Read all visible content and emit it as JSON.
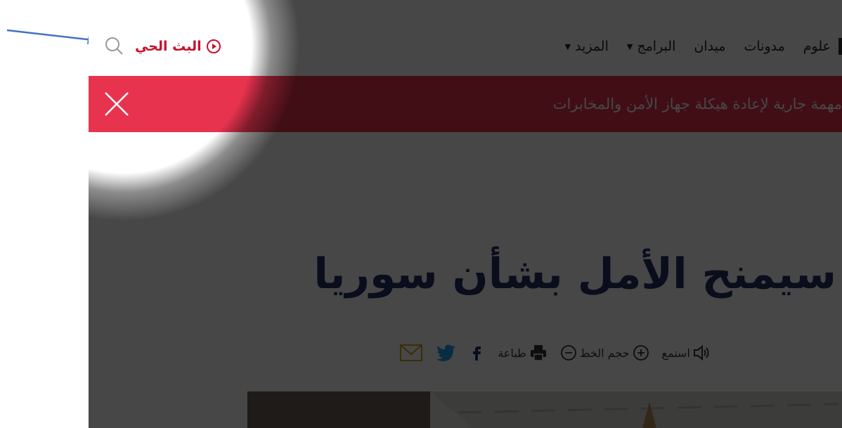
{
  "header": {
    "live_label": "البث الحي",
    "search_icon": "search-icon",
    "nav": [
      {
        "label": "علوم",
        "dropdown": false
      },
      {
        "label": "مدونات",
        "dropdown": false
      },
      {
        "label": "ميدان",
        "dropdown": false
      },
      {
        "label": "البرامج",
        "dropdown": true
      },
      {
        "label": "المزيد",
        "dropdown": true
      }
    ]
  },
  "alert": {
    "text": "مهمة جارية لإعادة هيكلة جهاز الأمن والمخابرات",
    "close_icon": "close-icon",
    "color": "#e8334f"
  },
  "article": {
    "headline": "سيمنح الأمل بشأن سوريا",
    "tools": {
      "listen": "استمع",
      "font_size": "حجم الخط",
      "print": "طباعة"
    }
  },
  "colors": {
    "accent": "#c8102e",
    "headline": "#1f2d64",
    "twitter": "#1da1f2",
    "facebook": "#1c2b6e",
    "email": "#d6a21e",
    "annotation_arrow": "#4472c4"
  }
}
